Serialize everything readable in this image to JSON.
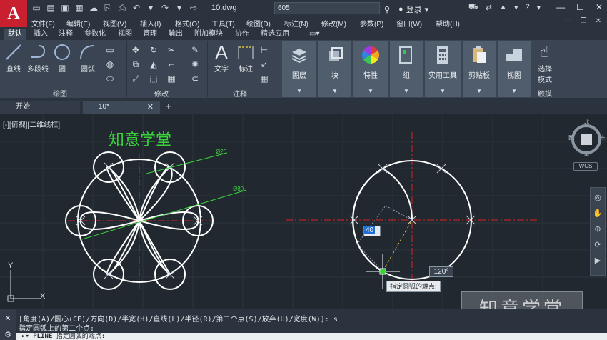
{
  "app": {
    "logo_letter": "A",
    "document_title": "10.dwg",
    "search_value": "605",
    "login_label": "登录",
    "accent": "#c8202f"
  },
  "menu": [
    "文件(F)",
    "编辑(E)",
    "视图(V)",
    "插入(I)",
    "格式(O)",
    "工具(T)",
    "绘图(D)",
    "标注(N)",
    "修改(M)",
    "参数(P)",
    "窗口(W)",
    "帮助(H)"
  ],
  "ribbon_tabs": [
    "默认",
    "插入",
    "注释",
    "参数化",
    "视图",
    "管理",
    "输出",
    "附加模块",
    "协作",
    "精选应用"
  ],
  "ribbon": {
    "draw_tools": [
      "直线",
      "多段线",
      "圆",
      "圆弧"
    ],
    "panel_draw": "绘图",
    "panel_modify": "修改",
    "text_tool": "文字",
    "dim_tool": "标注",
    "panel_annot": "注释",
    "tiles": [
      "图层",
      "块",
      "特性",
      "组",
      "实用工具",
      "剪贴板",
      "视图"
    ],
    "select_mode": [
      "选择",
      "模式"
    ],
    "touch": "触摸"
  },
  "doc_tabs": {
    "start": "开始",
    "active": "10*"
  },
  "canvas": {
    "view_label": "[-][俯视][二维线框]",
    "title_cn": "知意学堂",
    "dim_small": "Ø20",
    "dim_large": "Ø80",
    "input_value": "40",
    "angle_value": "120°",
    "prompt_tip": "指定圆弧的端点:",
    "watermark": "知意学堂",
    "wcs": "WCS",
    "axis_y": "Y",
    "axis_x": "X",
    "compass": {
      "n": "北",
      "s": "南",
      "e": "东",
      "w": "西",
      "face": "上"
    }
  },
  "command": {
    "history_1": "[角度(A)/圆心(CE)/方向(D)/半宽(H)/直线(L)/半径(R)/第二个点(S)/放弃(U)/宽度(W)]: s",
    "history_2": "指定圆弧上的第二个点:",
    "input_cmd": "PLINE",
    "input_prompt": "指定圆弧的端点:"
  }
}
